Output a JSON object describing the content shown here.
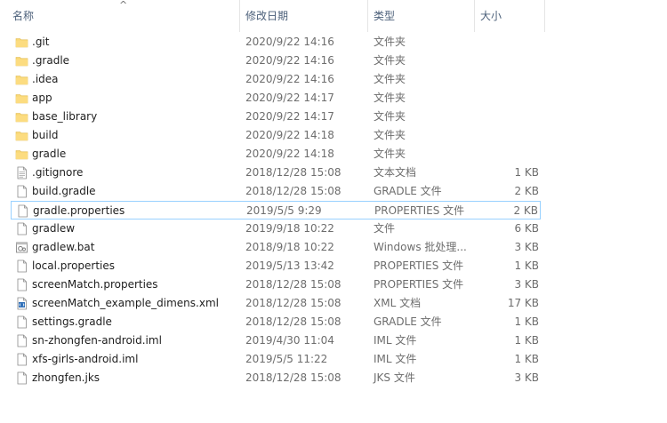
{
  "header": {
    "name": "名称",
    "date": "修改日期",
    "type": "类型",
    "size": "大小",
    "sort_indicator": "^"
  },
  "files": [
    {
      "name": ".git",
      "date": "2020/9/22 14:16",
      "type": "文件夹",
      "size": "",
      "icon": "folder-icon"
    },
    {
      "name": ".gradle",
      "date": "2020/9/22 14:16",
      "type": "文件夹",
      "size": "",
      "icon": "folder-icon"
    },
    {
      "name": ".idea",
      "date": "2020/9/22 14:16",
      "type": "文件夹",
      "size": "",
      "icon": "folder-icon"
    },
    {
      "name": "app",
      "date": "2020/9/22 14:17",
      "type": "文件夹",
      "size": "",
      "icon": "folder-icon"
    },
    {
      "name": "base_library",
      "date": "2020/9/22 14:17",
      "type": "文件夹",
      "size": "",
      "icon": "folder-icon"
    },
    {
      "name": "build",
      "date": "2020/9/22 14:18",
      "type": "文件夹",
      "size": "",
      "icon": "folder-icon"
    },
    {
      "name": "gradle",
      "date": "2020/9/22 14:18",
      "type": "文件夹",
      "size": "",
      "icon": "folder-icon"
    },
    {
      "name": ".gitignore",
      "date": "2018/12/28 15:08",
      "type": "文本文档",
      "size": "1 KB",
      "icon": "text-file-icon"
    },
    {
      "name": "build.gradle",
      "date": "2018/12/28 15:08",
      "type": "GRADLE 文件",
      "size": "2 KB",
      "icon": "file-icon"
    },
    {
      "name": "gradle.properties",
      "date": "2019/5/5 9:29",
      "type": "PROPERTIES 文件",
      "size": "2 KB",
      "icon": "file-icon",
      "selected": true
    },
    {
      "name": "gradlew",
      "date": "2019/9/18 10:22",
      "type": "文件",
      "size": "6 KB",
      "icon": "file-icon"
    },
    {
      "name": "gradlew.bat",
      "date": "2018/9/18 10:22",
      "type": "Windows 批处理...",
      "size": "3 KB",
      "icon": "batch-file-icon"
    },
    {
      "name": "local.properties",
      "date": "2019/5/13 13:42",
      "type": "PROPERTIES 文件",
      "size": "1 KB",
      "icon": "file-icon"
    },
    {
      "name": "screenMatch.properties",
      "date": "2018/12/28 15:08",
      "type": "PROPERTIES 文件",
      "size": "3 KB",
      "icon": "file-icon"
    },
    {
      "name": "screenMatch_example_dimens.xml",
      "date": "2018/12/28 15:08",
      "type": "XML 文档",
      "size": "17 KB",
      "icon": "xml-file-icon"
    },
    {
      "name": "settings.gradle",
      "date": "2018/12/28 15:08",
      "type": "GRADLE 文件",
      "size": "1 KB",
      "icon": "file-icon"
    },
    {
      "name": "sn-zhongfen-android.iml",
      "date": "2019/4/30 11:04",
      "type": "IML 文件",
      "size": "1 KB",
      "icon": "file-icon"
    },
    {
      "name": "xfs-girls-android.iml",
      "date": "2019/5/5 11:22",
      "type": "IML 文件",
      "size": "1 KB",
      "icon": "file-icon"
    },
    {
      "name": "zhongfen.jks",
      "date": "2018/12/28 15:08",
      "type": "JKS 文件",
      "size": "3 KB",
      "icon": "file-icon"
    }
  ],
  "colors": {
    "header_text": "#4c607a",
    "meta_text": "#6d6d6d",
    "selection_border": "#99d1ff",
    "folder": "#f8d775"
  }
}
